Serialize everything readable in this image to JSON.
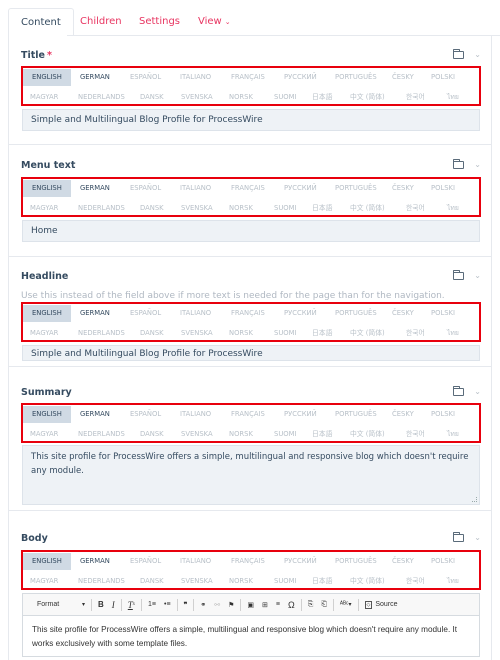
{
  "tabs": [
    {
      "label": "Content",
      "active": true
    },
    {
      "label": "Children"
    },
    {
      "label": "Settings"
    },
    {
      "label": "View",
      "has_dropdown": true
    }
  ],
  "languages_row1": [
    "ENGLISH",
    "GERMAN",
    "ESPAÑOL",
    "ITALIANO",
    "FRANÇAIS",
    "РУССКИЙ",
    "PORTUGUÊS",
    "ČESKY",
    "POLSKI"
  ],
  "languages_row2": [
    "MAGYAR",
    "NEDERLANDS",
    "DANSK",
    "SVENSKA",
    "NORSK",
    "SUOMI",
    "日本語",
    "中文 (简体)",
    "한국어",
    "ไทย"
  ],
  "active_language": "ENGLISH",
  "fields": {
    "title": {
      "label": "Title",
      "required_mark": "*",
      "value": "Simple and Multilingual Blog Profile for ProcessWire"
    },
    "menu_text": {
      "label": "Menu text",
      "value": "Home"
    },
    "headline": {
      "label": "Headline",
      "description": "Use this instead of the field above if more text is needed for the page than for the navigation.",
      "value": "Simple and Multilingual Blog Profile for ProcessWire"
    },
    "summary": {
      "label": "Summary",
      "value": "This site profile for ProcessWire offers a simple, multilingual and responsive blog which doesn't require any module."
    },
    "body": {
      "label": "Body",
      "value": "This site profile for ProcessWire offers a simple, multilingual and responsive blog which doesn't require any module. It works exclusively with some template files.",
      "toolbar": {
        "format_label": "Format",
        "bold": "B",
        "italic": "I",
        "remove_format": "Tx",
        "ordered_list": "1≡",
        "bulleted_list": "•≡",
        "blockquote": "❞",
        "link": "⚭",
        "unlink": "⚯",
        "anchor": "⚑",
        "image": "▣",
        "table": "⊞",
        "hr": "≡",
        "special_char": "Ω",
        "paste_text": "⎘",
        "paste_word": "⎗",
        "spellcheck": "ᴬᴮᶜ",
        "source_label": "Source"
      }
    }
  },
  "colors": {
    "accent": "#e83561",
    "highlight_border": "#e8000d",
    "active_lang_bg": "#d0dae4",
    "input_bg": "#eef2f6",
    "text": "#354b60"
  }
}
